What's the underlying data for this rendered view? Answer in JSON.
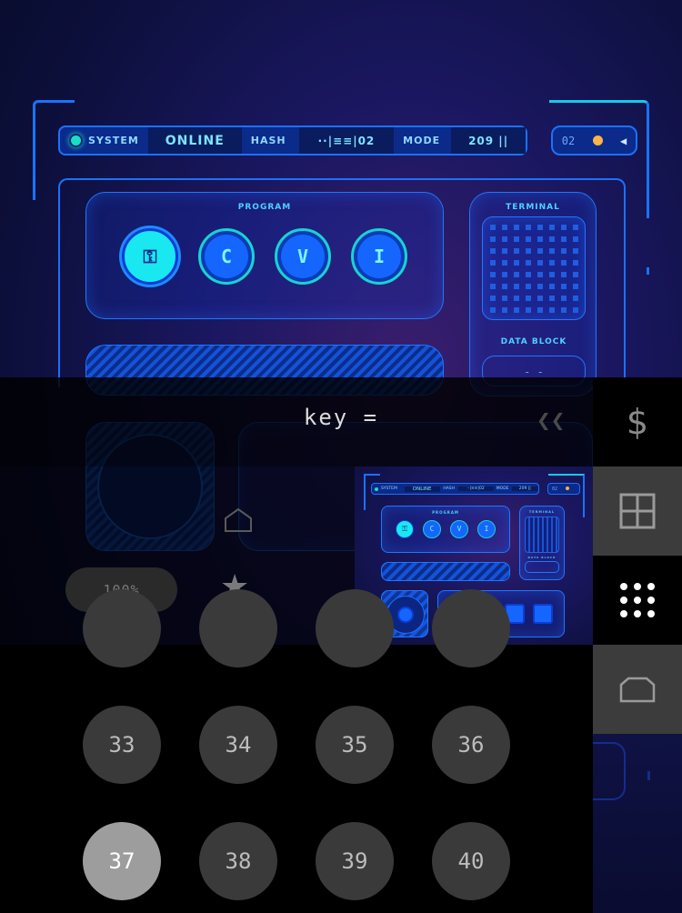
{
  "game": {
    "topbar": {
      "system_label": "SYSTEM",
      "status": "ONLINE",
      "hash_label": "HASH",
      "hash_value": "··|≡≡|02",
      "mode_label": "MODE",
      "mode_value": "209 ||"
    },
    "right_counter": "02",
    "program": {
      "label": "PROGRAM",
      "buttons": [
        "⚿",
        "C",
        "V",
        "I"
      ]
    },
    "terminal": {
      "label": "TERMINAL",
      "data_block_label": "DATA BLOCK",
      "data_block_value": "- -"
    },
    "thumbnail": {
      "system_label": "SYSTEM",
      "status": "ONLINE",
      "hash_label": "HASH",
      "hash_value": "··|≡≡|02",
      "mode_label": "MODE",
      "mode_value": "209 ||",
      "counter": "02",
      "program_label": "PROGRAM",
      "terminal_label": "TERMINAL",
      "data_block_label": "DATA BLOCK",
      "buttons": [
        "⚿",
        "C",
        "V",
        "I"
      ]
    }
  },
  "overlay": {
    "key_text": "key =",
    "back_glyph": "❮❮",
    "zoom": "100%",
    "home_glyph": "⌂",
    "star_glyph": "★"
  },
  "sidebar": {
    "items": [
      {
        "icon": "dollar-icon",
        "glyph": "$"
      },
      {
        "icon": "grid-icon"
      },
      {
        "icon": "dots-grid-icon"
      },
      {
        "icon": "folder-icon"
      }
    ]
  },
  "numbers": [
    "33",
    "34",
    "35",
    "36",
    "37",
    "38",
    "39",
    "40"
  ],
  "selected_number": "37"
}
